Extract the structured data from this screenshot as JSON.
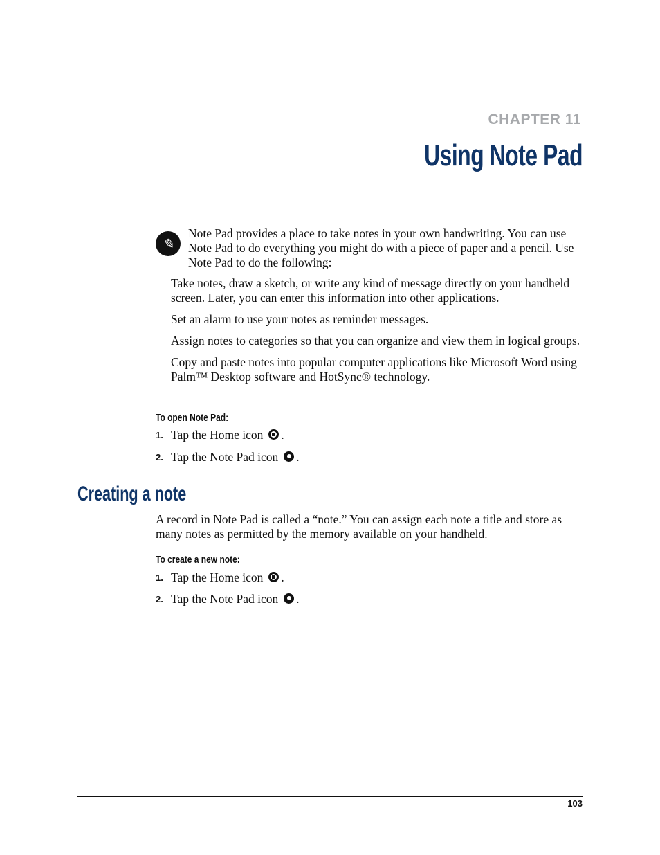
{
  "chapter": {
    "label": "CHAPTER 11",
    "title": "Using Note Pad"
  },
  "intro": {
    "icon": "note-pad-app-icon",
    "text": "Note Pad provides a place to take notes in your own handwriting. You can use Note Pad to do everything you might do with a piece of paper and a pencil. Use Note Pad to do the following:"
  },
  "bullets": [
    "Take notes, draw a sketch, or write any kind of message directly on your handheld screen. Later, you can enter this information into other applications.",
    "Set an alarm to use your notes as reminder messages.",
    "Assign notes to categories so that you can organize and view them in logical groups.",
    "Copy and paste notes into popular computer applications like Microsoft Word using Palm™ Desktop software and HotSync® technology."
  ],
  "open_procedure": {
    "heading": "To open Note Pad:",
    "steps": [
      {
        "num": "1.",
        "text": "Tap the Home icon",
        "icon": "home-icon",
        "end": "."
      },
      {
        "num": "2.",
        "text": "Tap the Note Pad icon",
        "icon": "note-pad-icon",
        "end": "."
      }
    ]
  },
  "section": {
    "title": "Creating a note",
    "body": "A record in Note Pad is called a “note.” You can assign each note a title and store as many notes as permitted by the memory available on your handheld."
  },
  "create_procedure": {
    "heading": "To create a new note:",
    "steps": [
      {
        "num": "1.",
        "text": "Tap the Home icon",
        "icon": "home-icon",
        "end": "."
      },
      {
        "num": "2.",
        "text": "Tap the Note Pad icon",
        "icon": "note-pad-icon",
        "end": "."
      }
    ]
  },
  "footer": {
    "page_number": "103"
  }
}
